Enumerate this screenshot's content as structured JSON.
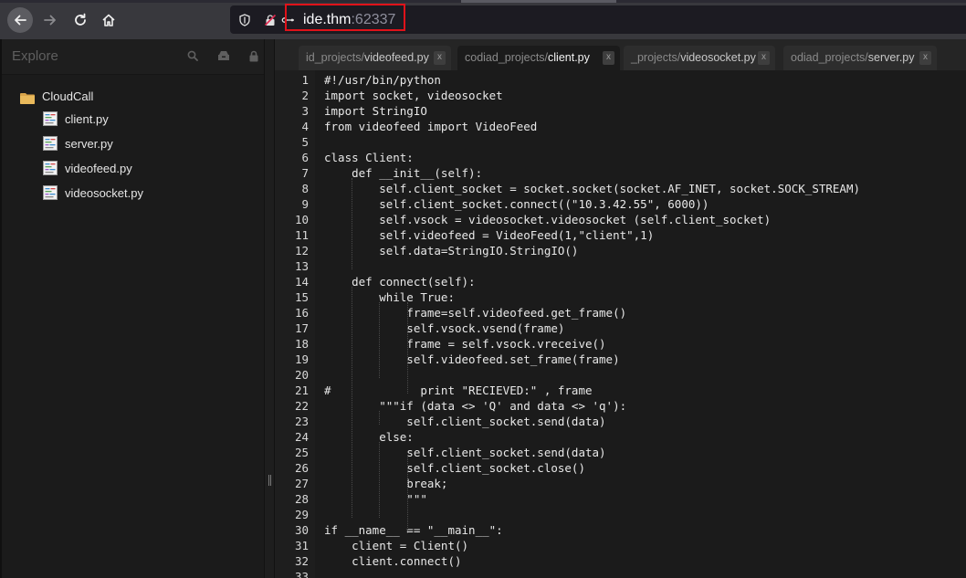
{
  "browser": {
    "url_host": "ide.thm",
    "url_port": ":62337",
    "icons": [
      "back-arrow-icon",
      "forward-arrow-icon",
      "reload-icon",
      "home-icon",
      "shield-icon",
      "insecure-lock-icon",
      "permissions-icon"
    ],
    "highlight_color": "#e0121a"
  },
  "sidebar": {
    "title": "Explore",
    "folder": "CloudCall",
    "files": [
      "client.py",
      "server.py",
      "videofeed.py",
      "videosocket.py"
    ]
  },
  "tabs": [
    {
      "prefix": "id_projects/",
      "name": "videofeed.py",
      "close": "x",
      "active": false
    },
    {
      "prefix": "codiad_projects/",
      "name": "client.py",
      "close": "x",
      "active": true
    },
    {
      "prefix": "_projects/",
      "name": "videosocket.py",
      "close": "x",
      "active": false
    },
    {
      "prefix": "odiad_projects/",
      "name": "server.py",
      "close": "x",
      "active": false
    }
  ],
  "code": [
    "#!/usr/bin/python",
    "import socket, videosocket",
    "import StringIO",
    "from videofeed import VideoFeed",
    "",
    "class Client:",
    "    def __init__(self):",
    "        self.client_socket = socket.socket(socket.AF_INET, socket.SOCK_STREAM)",
    "        self.client_socket.connect((\"10.3.42.55\", 6000))",
    "        self.vsock = videosocket.videosocket (self.client_socket)",
    "        self.videofeed = VideoFeed(1,\"client\",1)",
    "        self.data=StringIO.StringIO()",
    "",
    "    def connect(self):",
    "        while True:",
    "            frame=self.videofeed.get_frame()",
    "            self.vsock.vsend(frame)",
    "            frame = self.vsock.vreceive()",
    "            self.videofeed.set_frame(frame)",
    "",
    "#             print \"RECIEVED:\" , frame",
    "        \"\"\"if (data <> 'Q' and data <> 'q'):",
    "            self.client_socket.send(data)",
    "        else:",
    "            self.client_socket.send(data)",
    "            self.client_socket.close()",
    "            break;",
    "            \"\"\"",
    "",
    "if __name__ == \"__main__\":",
    "    client = Client()",
    "    client.connect()",
    ""
  ]
}
